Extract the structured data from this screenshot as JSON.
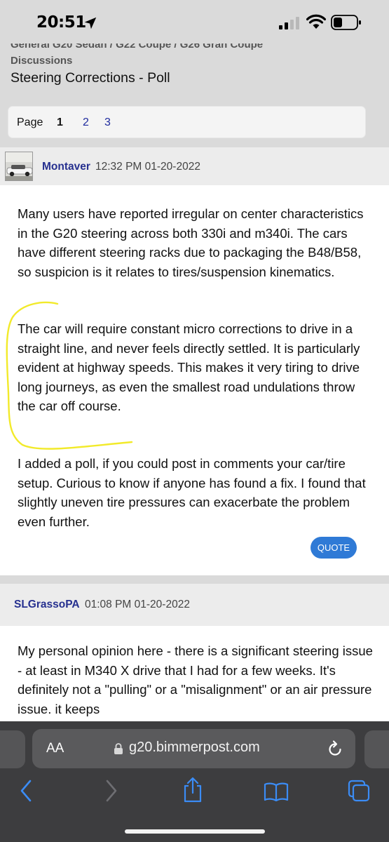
{
  "status_bar": {
    "time": "20:51"
  },
  "breadcrumb": {
    "forum_path": "General G20 Sedan / G22 Coupe / G26 Gran Coupe",
    "section": "Discussions"
  },
  "thread": {
    "title": "Steering Corrections - Poll"
  },
  "pagination": {
    "label": "Page",
    "current": "1",
    "pages": [
      "2",
      "3"
    ]
  },
  "posts": [
    {
      "author": "Montaver",
      "timestamp": "12:32 PM 01-20-2022",
      "paragraphs": [
        "Many users have reported irregular on center characteristics in the G20 steering across both 330i and m340i. The cars have different steering racks due to packaging the B48/B58, so suspicion is it relates to tires/suspension kinematics.",
        "The car will require constant micro corrections to drive in a straight line, and never feels directly settled. It is particularly evident at highway speeds. This makes it very tiring to drive long journeys, as even the smallest road undulations throw the car off course.",
        "I added a poll, if you could post in comments your car/tire setup. Curious to know if anyone has found a fix. I found that slightly uneven tire pressures can exacerbate the problem even further."
      ],
      "quote_label": "QUOTE"
    },
    {
      "author": "SLGrassoPA",
      "timestamp": "01:08 PM 01-20-2022",
      "paragraphs": [
        "My personal opinion here - there is a significant steering issue - at least in M340 X drive that I had for a few weeks. It's definitely not a \"pulling\" or a \"misalignment\" or an air pressure issue. it keeps"
      ]
    }
  ],
  "browser": {
    "text_size_label": "AA",
    "url": "g20.bimmerpost.com"
  },
  "colors": {
    "link_blue": "#26308f",
    "quote_button": "#2f7ad6",
    "highlight_annotation": "#f2ea2a",
    "browser_chrome": "#3d3d3f",
    "toolbar_icon": "#3b8cf5"
  },
  "icons": [
    "location-arrow-icon",
    "cellular-signal-icon",
    "wifi-icon",
    "battery-icon",
    "lock-icon",
    "reload-icon",
    "back-icon",
    "forward-icon",
    "share-icon",
    "bookmarks-icon",
    "tabs-icon"
  ]
}
